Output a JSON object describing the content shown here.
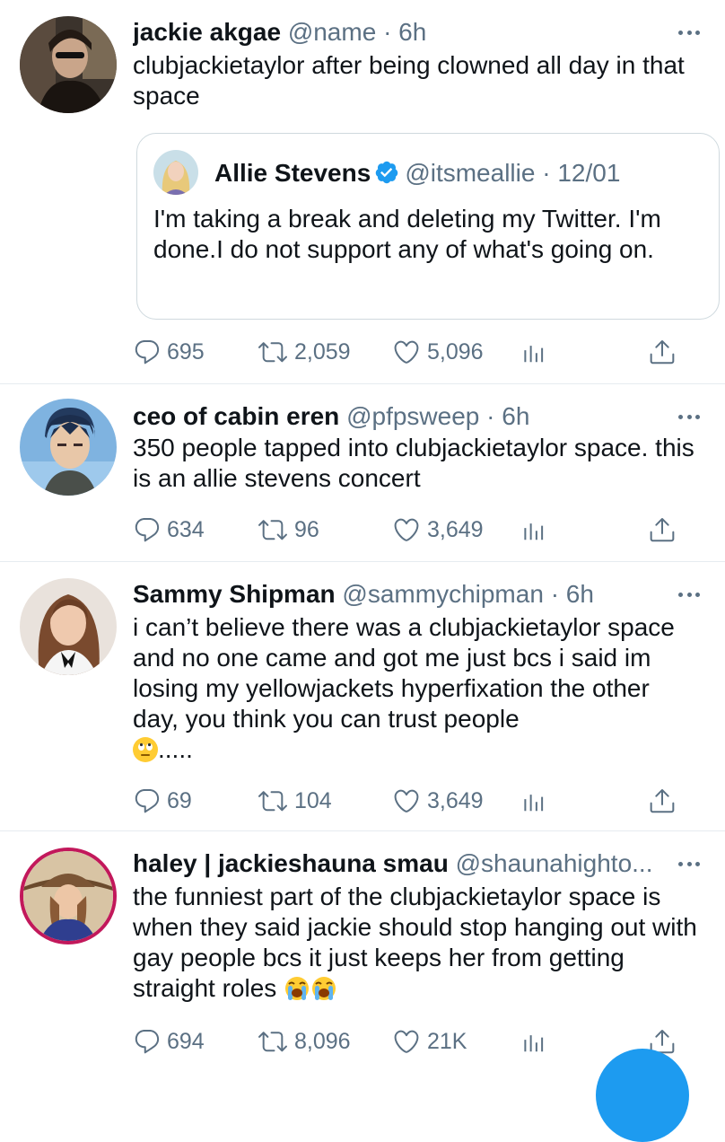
{
  "tweets": [
    {
      "name": "jackie akgae",
      "handle": "@name",
      "time": "6h",
      "text": "clubjackietaylor after being clowned all day in that space",
      "quote": {
        "name": "Allie Stevens",
        "handle": "@itsmeallie",
        "time": "12/01",
        "text": "I'm taking a break and deleting my Twitter. I'm done.I do not support any of what's going on."
      },
      "replies": "695",
      "retweets": "2,059",
      "likes": "5,096"
    },
    {
      "name": "ceo of cabin eren",
      "handle": "@pfpsweep",
      "time": "6h",
      "text": "350 people tapped into clubjackietaylor space. this is an allie stevens concert",
      "replies": "634",
      "retweets": "96",
      "likes": "3,649"
    },
    {
      "name": "Sammy Shipman",
      "handle": "@sammychipman",
      "time": "6h",
      "text": "i can’t believe there was a clubjackietaylor space and no one came and got me just bcs i said im losing my yellowjackets hyperfixation the other day, you think you can trust people",
      "text_suffix": ".....",
      "replies": "69",
      "retweets": "104",
      "likes": "3,649"
    },
    {
      "name": "haley | jackieshauna smau",
      "handle": "@shaunahighto...",
      "time": "",
      "text": "the funniest part of the clubjackietaylor space is when they said jackie should stop hanging out with gay people bcs it just keeps her from getting straight roles",
      "replies": "694",
      "retweets": "8,096",
      "likes": "21K"
    }
  ],
  "separator": "·",
  "icons": {
    "reply": "reply-icon",
    "retweet": "retweet-icon",
    "like": "heart-icon",
    "analytics": "analytics-icon",
    "share": "share-icon",
    "more": "more-icon",
    "verified": "verified-badge-icon"
  },
  "colors": {
    "accent": "#1d9bf0",
    "secondary_text": "#5b7083",
    "divider": "#e6ecf0"
  }
}
